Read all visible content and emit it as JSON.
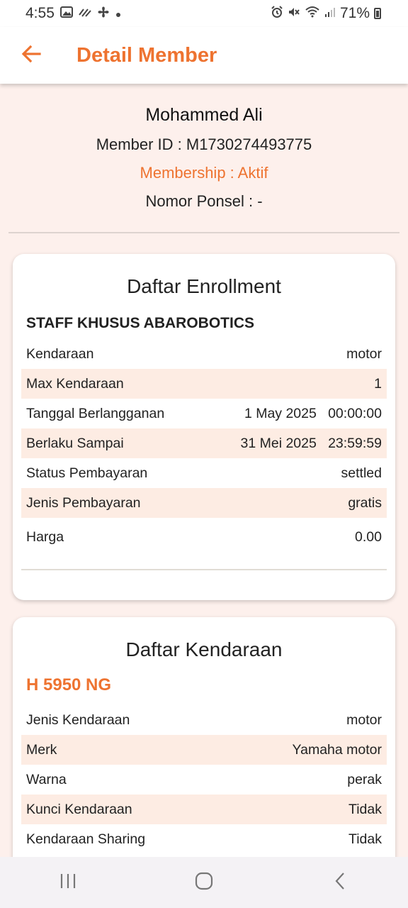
{
  "status_bar": {
    "time": "4:55",
    "battery": "71%"
  },
  "app_bar": {
    "title": "Detail Member"
  },
  "member": {
    "name": "Mohammed Ali",
    "id_line": "Member ID : M1730274493775",
    "membership_line": "Membership : Aktif",
    "phone_line": "Nomor Ponsel : -"
  },
  "enrollment": {
    "title": "Daftar Enrollment",
    "program": "STAFF KHUSUS ABAROBOTICS",
    "rows": [
      {
        "label": "Kendaraan",
        "value": "motor"
      },
      {
        "label": "Max Kendaraan",
        "value": "1"
      },
      {
        "label": "Tanggal Berlangganan",
        "value": "1 May 2025   00:00:00"
      },
      {
        "label": "Berlaku Sampai",
        "value": "31 Mei 2025   23:59:59"
      },
      {
        "label": "Status Pembayaran",
        "value": "settled"
      },
      {
        "label": "Jenis Pembayaran",
        "value": "gratis"
      },
      {
        "label": "Harga",
        "value": "0.00"
      }
    ]
  },
  "vehicles": {
    "title": "Daftar Kendaraan",
    "plate": "H 5950 NG",
    "rows": [
      {
        "label": "Jenis Kendaraan",
        "value": "motor"
      },
      {
        "label": "Merk",
        "value": "Yamaha motor"
      },
      {
        "label": "Warna",
        "value": "perak"
      },
      {
        "label": "Kunci Kendaraan",
        "value": "Tidak"
      },
      {
        "label": "Kendaraan Sharing",
        "value": "Tidak"
      }
    ]
  },
  "colors": {
    "accent": "#ee7330",
    "background": "#fdf0ec",
    "row_shade": "#fdece3"
  },
  "icons": {
    "back": "arrow-left-icon",
    "nav_recent": "recent-apps-icon",
    "nav_home": "home-icon",
    "nav_back": "chevron-left-icon"
  }
}
